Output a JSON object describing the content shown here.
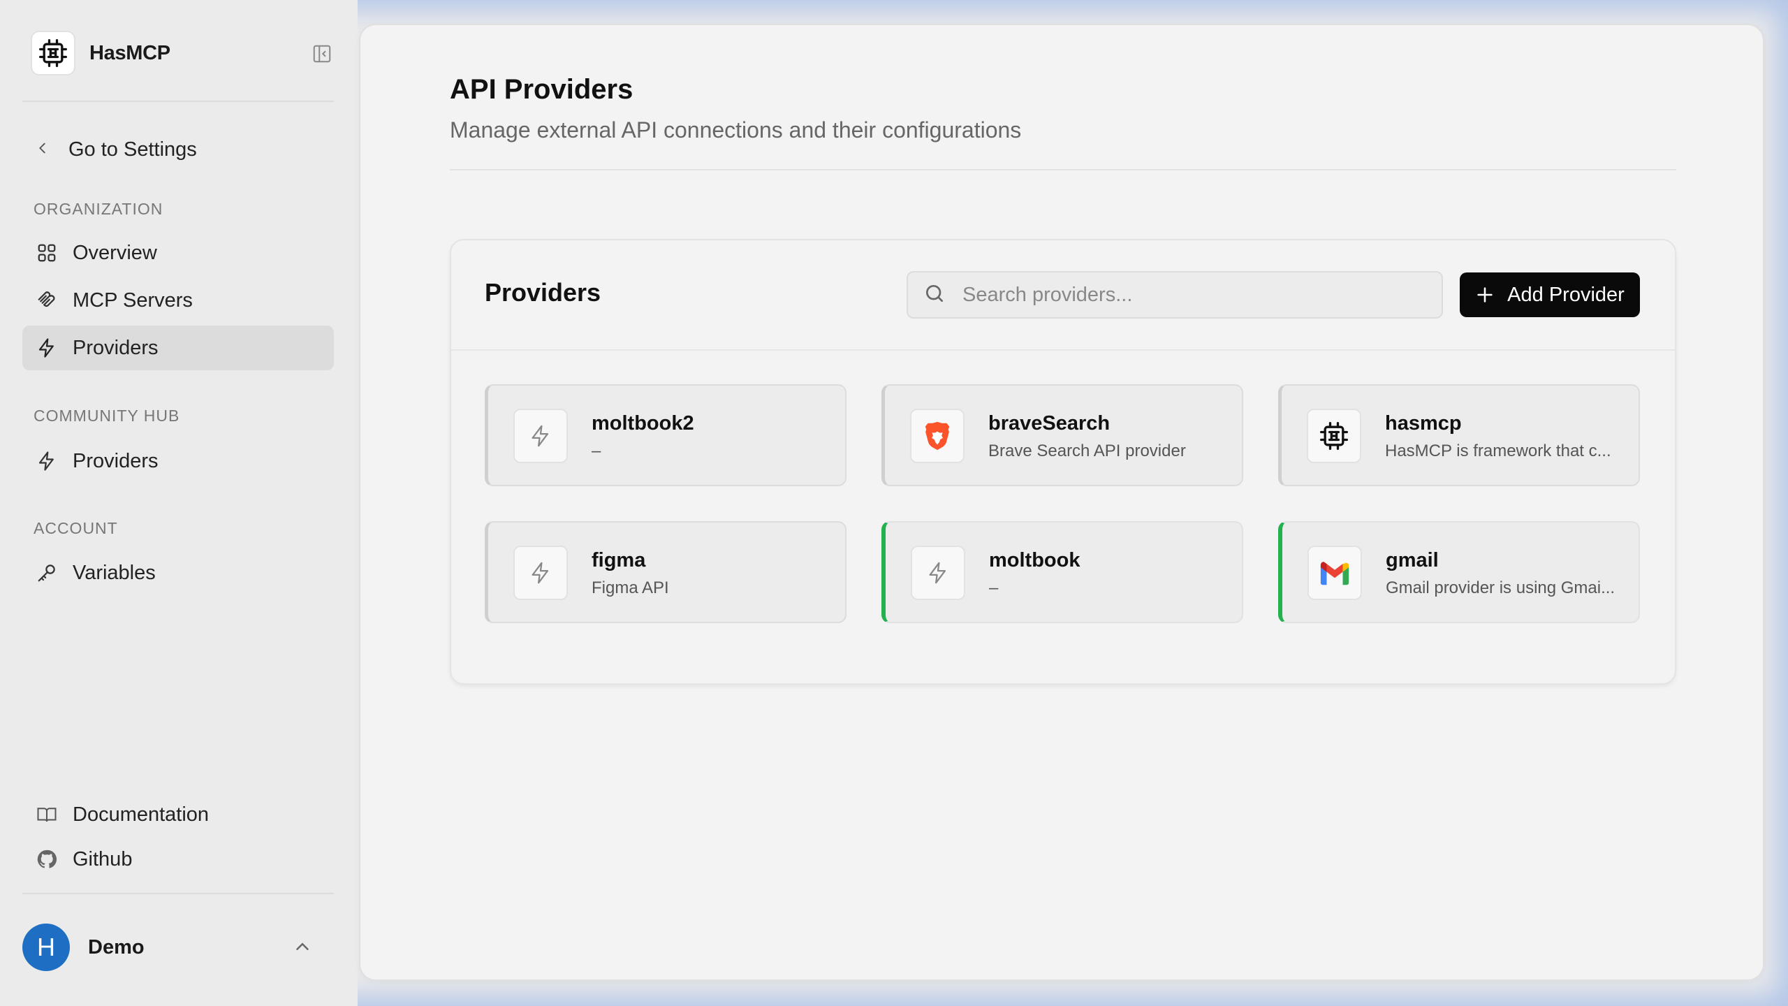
{
  "sidebar": {
    "brand": "HasMCP",
    "back_link": "Go to Settings",
    "sections": [
      {
        "label": "ORGANIZATION",
        "items": [
          {
            "label": "Overview",
            "icon": "grid-icon"
          },
          {
            "label": "MCP Servers",
            "icon": "mcp-icon"
          },
          {
            "label": "Providers",
            "icon": "bolt-icon",
            "active": true
          }
        ]
      },
      {
        "label": "COMMUNITY HUB",
        "items": [
          {
            "label": "Providers",
            "icon": "bolt-icon"
          }
        ]
      },
      {
        "label": "ACCOUNT",
        "items": [
          {
            "label": "Variables",
            "icon": "key-icon"
          }
        ]
      }
    ],
    "footer_links": [
      {
        "label": "Documentation",
        "icon": "book-icon"
      },
      {
        "label": "Github",
        "icon": "github-icon"
      }
    ],
    "user": {
      "initial": "H",
      "name": "Demo"
    }
  },
  "header": {
    "title": "API Providers",
    "subtitle": "Manage external API connections and their configurations"
  },
  "providers_panel": {
    "title": "Providers",
    "search_placeholder": "Search providers...",
    "add_button": "Add Provider",
    "items": [
      {
        "name": "moltbook2",
        "description": "–",
        "icon": "bolt-icon",
        "active": false
      },
      {
        "name": "braveSearch",
        "description": "Brave Search API provider",
        "icon": "brave-icon",
        "active": false
      },
      {
        "name": "hasmcp",
        "description": "HasMCP is framework that c...",
        "icon": "hasmcp-icon",
        "active": false
      },
      {
        "name": "figma",
        "description": "Figma API",
        "icon": "bolt-icon",
        "active": false
      },
      {
        "name": "moltbook",
        "description": "–",
        "icon": "bolt-icon",
        "active": true
      },
      {
        "name": "gmail",
        "description": "Gmail provider is using Gmai...",
        "icon": "gmail-icon",
        "active": true
      }
    ]
  },
  "colors": {
    "accent": "#0a0a0a",
    "active_indicator": "#22b14c",
    "avatar": "#1e6fc4"
  }
}
